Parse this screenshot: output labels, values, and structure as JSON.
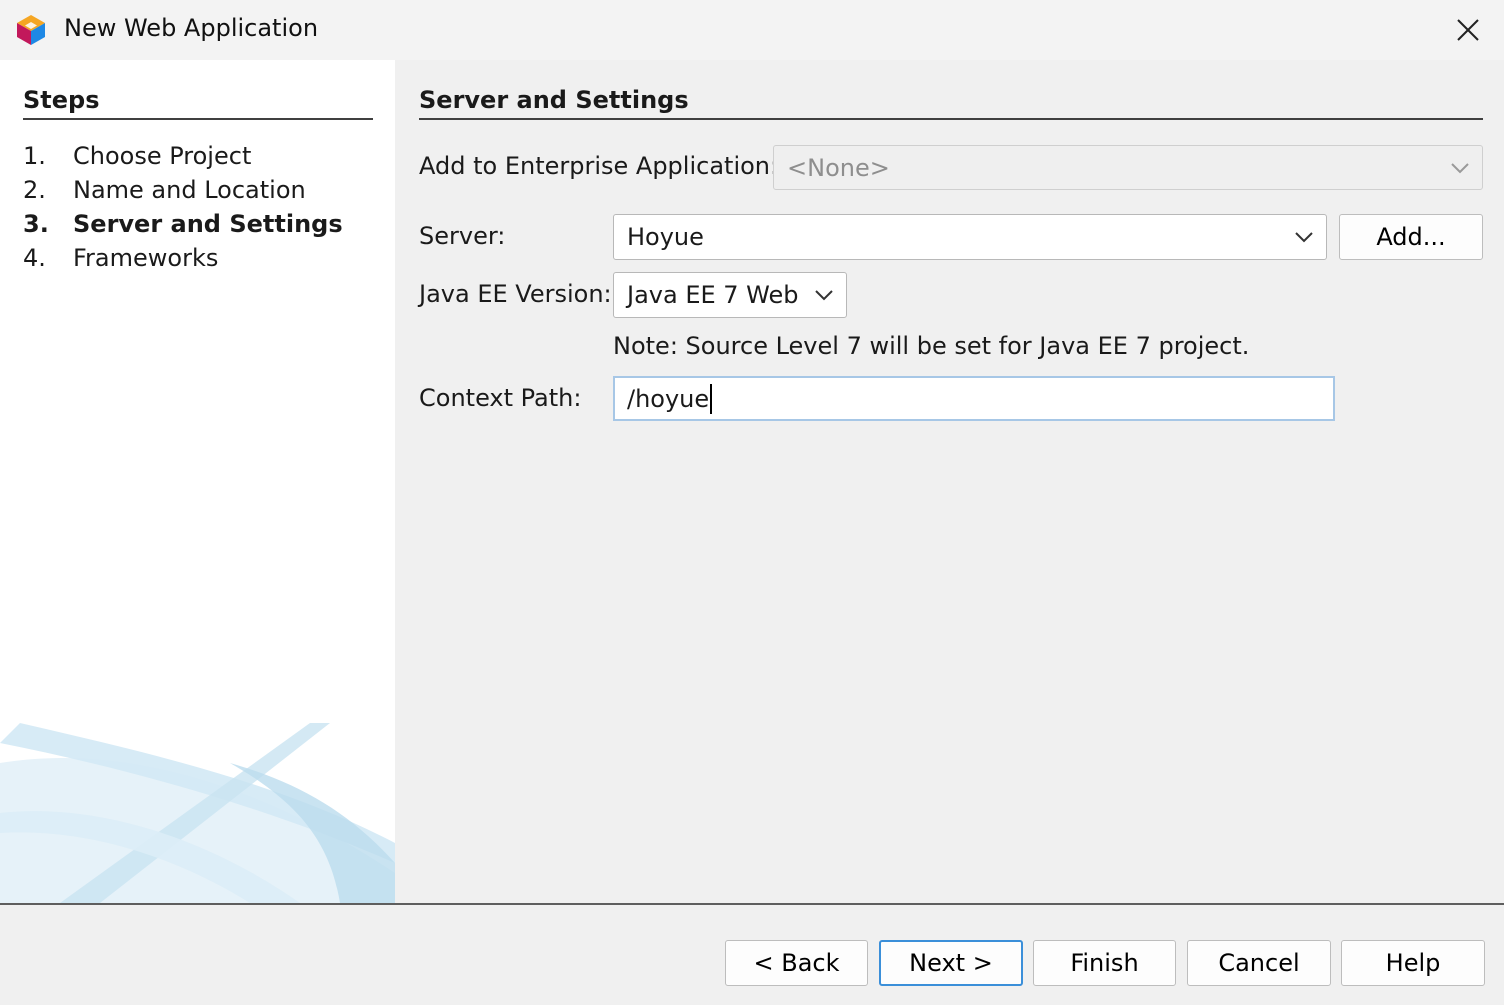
{
  "window": {
    "title": "New Web Application",
    "icon": "netbeans-cube-icon",
    "close_icon": "close-icon"
  },
  "steps": {
    "heading": "Steps",
    "items": [
      {
        "num": "1.",
        "label": "Choose Project"
      },
      {
        "num": "2.",
        "label": "Name and Location"
      },
      {
        "num": "3.",
        "label": "Server and Settings",
        "current": true
      },
      {
        "num": "4.",
        "label": "Frameworks"
      }
    ]
  },
  "content": {
    "heading": "Server and Settings",
    "enterprise_label": "Add to Enterprise Application:",
    "enterprise_value": "<None>",
    "server_label": "Server:",
    "server_value": "Hoyue",
    "add_button": "Add...",
    "javaee_label": "Java EE Version:",
    "javaee_value": "Java EE 7 Web",
    "note": "Note: Source Level 7 will be set for Java EE 7 project.",
    "context_label": "Context Path:",
    "context_value": "/hoyue"
  },
  "footer": {
    "back": "< Back",
    "next": "Next >",
    "finish": "Finish",
    "cancel": "Cancel",
    "help": "Help"
  },
  "colors": {
    "focus_border": "#3b8fd9",
    "input_focus": "#a7c7e6",
    "panel_bg": "#f0f0f0"
  }
}
